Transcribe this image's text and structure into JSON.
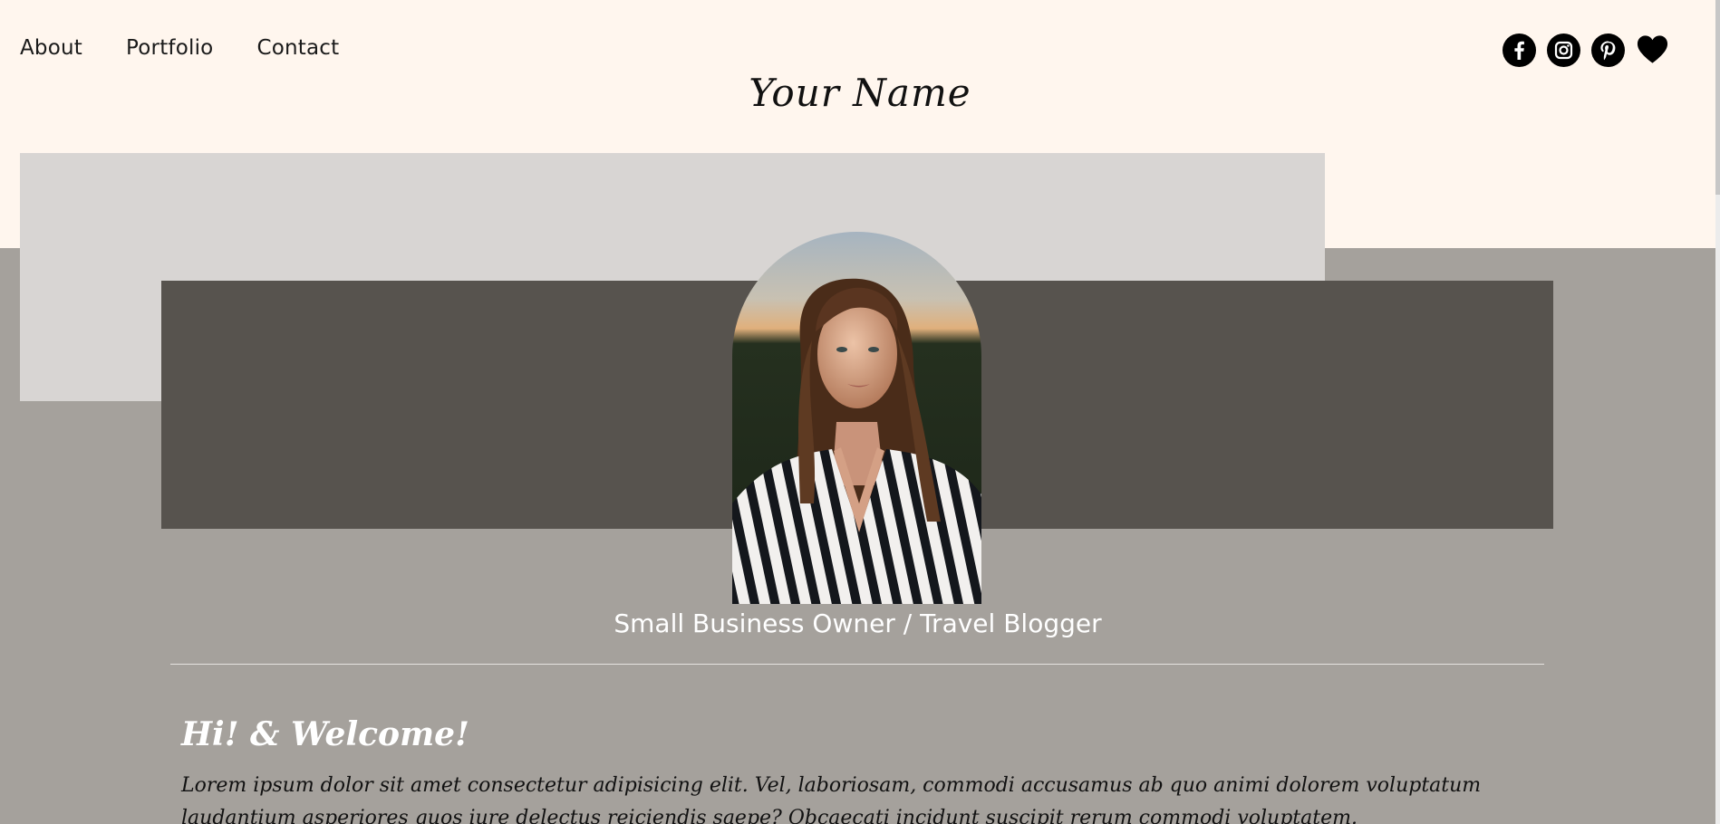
{
  "nav": {
    "items": [
      {
        "label": "About"
      },
      {
        "label": "Portfolio"
      },
      {
        "label": "Contact"
      }
    ]
  },
  "social": {
    "icons": [
      "facebook-icon",
      "instagram-icon",
      "pinterest-icon",
      "heart-icon"
    ]
  },
  "header": {
    "logo_text": "Your Name"
  },
  "hero": {
    "tagline": "Small Business Owner / Travel Blogger"
  },
  "intro": {
    "heading": "Hi! & Welcome!",
    "body": "Lorem ipsum dolor sit amet consectetur adipisicing elit. Vel, laboriosam, commodi accusamus ab quo animi dolorem voluptatum laudantium asperiores quos iure delectus reiciendis saepe? Obcaecati incidunt suscipit rerum commodi voluptatem."
  },
  "colors": {
    "header_bg": "#fff6ee",
    "band_bg": "#a5a19c",
    "light_block": "#d8d5d3",
    "dark_block": "#57534e"
  }
}
